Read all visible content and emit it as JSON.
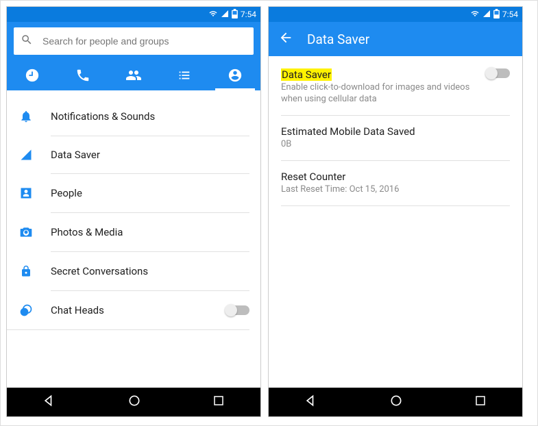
{
  "status": {
    "time": "7:54"
  },
  "screen1": {
    "search": {
      "placeholder": "Search for people and groups"
    },
    "settings": [
      {
        "icon": "bell-icon",
        "label": "Notifications & Sounds",
        "toggle": false
      },
      {
        "icon": "signal-icon",
        "label": "Data Saver",
        "toggle": false
      },
      {
        "icon": "person-icon",
        "label": "People",
        "toggle": false
      },
      {
        "icon": "camera-icon",
        "label": "Photos & Media",
        "toggle": false
      },
      {
        "icon": "lock-icon",
        "label": "Secret Conversations",
        "toggle": false
      },
      {
        "icon": "chatheads-icon",
        "label": "Chat Heads",
        "toggle": true
      }
    ]
  },
  "screen2": {
    "title": "Data Saver",
    "rows": {
      "r1": {
        "primary": "Data Saver",
        "secondary": "Enable click-to-download for images and videos when using cellular data"
      },
      "r2": {
        "primary": "Estimated Mobile Data Saved",
        "secondary": "0B"
      },
      "r3": {
        "primary": "Reset Counter",
        "secondary": "Last Reset Time: Oct 15, 2016"
      }
    }
  }
}
